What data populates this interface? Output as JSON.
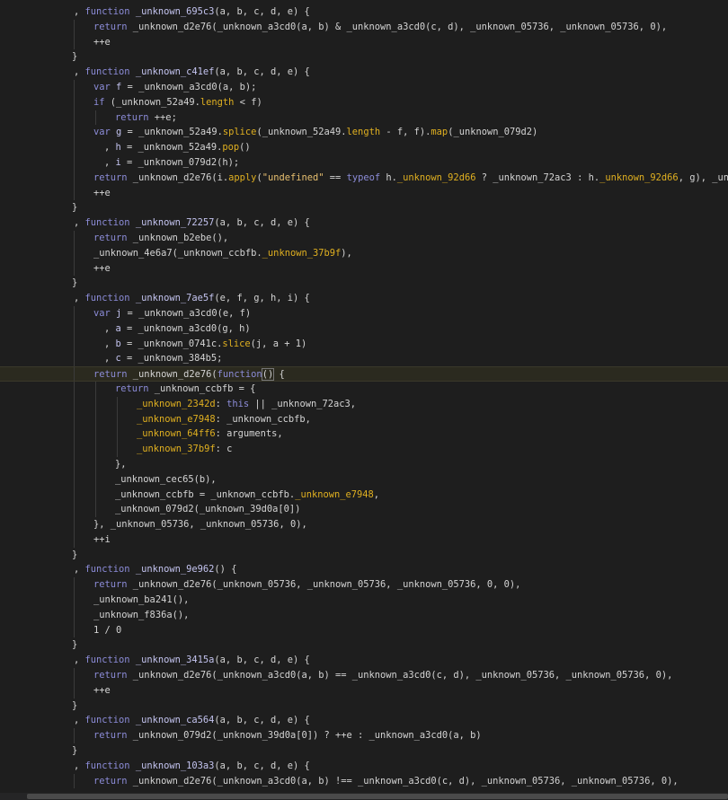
{
  "editor": {
    "current_line": 24,
    "lines": [
      {
        "indent": 82,
        "guides": [],
        "tokens": [
          {
            "t": ", ",
            "c": "pn"
          },
          {
            "t": "function ",
            "c": "kw"
          },
          {
            "t": "_unknown_695c3",
            "c": "fn"
          },
          {
            "t": "(a, b, c, d, e) {",
            "c": "pn"
          }
        ]
      },
      {
        "indent": 104,
        "guides": [
          82
        ],
        "tokens": [
          {
            "t": "return ",
            "c": "kw"
          },
          {
            "t": "_unknown_d2e76(_unknown_a3cd0(a, b) & _unknown_a3cd0(c, d), _unknown_05736, _unknown_05736, 0),",
            "c": "id"
          }
        ]
      },
      {
        "indent": 104,
        "guides": [
          82
        ],
        "tokens": [
          {
            "t": "++e",
            "c": "id"
          }
        ]
      },
      {
        "indent": 80,
        "guides": [],
        "tokens": [
          {
            "t": "}",
            "c": "pn"
          }
        ]
      },
      {
        "indent": 82,
        "guides": [],
        "tokens": [
          {
            "t": ", ",
            "c": "pn"
          },
          {
            "t": "function ",
            "c": "kw"
          },
          {
            "t": "_unknown_c41ef",
            "c": "fn"
          },
          {
            "t": "(a, b, c, d, e) {",
            "c": "pn"
          }
        ]
      },
      {
        "indent": 104,
        "guides": [
          82
        ],
        "tokens": [
          {
            "t": "var ",
            "c": "kw"
          },
          {
            "t": "f",
            "c": "fn"
          },
          {
            "t": " = _unknown_a3cd0(a, b);",
            "c": "id"
          }
        ]
      },
      {
        "indent": 104,
        "guides": [
          82
        ],
        "tokens": [
          {
            "t": "if ",
            "c": "kw"
          },
          {
            "t": "(_unknown_52a49.",
            "c": "id"
          },
          {
            "t": "length",
            "c": "prop"
          },
          {
            "t": " < f)",
            "c": "id"
          }
        ]
      },
      {
        "indent": 128,
        "guides": [
          82,
          106
        ],
        "tokens": [
          {
            "t": "return ",
            "c": "kw"
          },
          {
            "t": "++e;",
            "c": "id"
          }
        ]
      },
      {
        "indent": 104,
        "guides": [
          82
        ],
        "tokens": [
          {
            "t": "var ",
            "c": "kw"
          },
          {
            "t": "g",
            "c": "fn"
          },
          {
            "t": " = _unknown_52a49.",
            "c": "id"
          },
          {
            "t": "splice",
            "c": "prop"
          },
          {
            "t": "(_unknown_52a49.",
            "c": "id"
          },
          {
            "t": "length",
            "c": "prop"
          },
          {
            "t": " - f, f).",
            "c": "id"
          },
          {
            "t": "map",
            "c": "prop"
          },
          {
            "t": "(_unknown_079d2)",
            "c": "id"
          }
        ]
      },
      {
        "indent": 116,
        "guides": [
          82
        ],
        "tokens": [
          {
            "t": ", ",
            "c": "pn"
          },
          {
            "t": "h",
            "c": "fn"
          },
          {
            "t": " = _unknown_52a49.",
            "c": "id"
          },
          {
            "t": "pop",
            "c": "prop"
          },
          {
            "t": "()",
            "c": "id"
          }
        ]
      },
      {
        "indent": 116,
        "guides": [
          82
        ],
        "tokens": [
          {
            "t": ", ",
            "c": "pn"
          },
          {
            "t": "i",
            "c": "fn"
          },
          {
            "t": " = _unknown_079d2(h);",
            "c": "id"
          }
        ]
      },
      {
        "indent": 104,
        "guides": [
          82
        ],
        "tokens": [
          {
            "t": "return ",
            "c": "kw"
          },
          {
            "t": "_unknown_d2e76(i.",
            "c": "id"
          },
          {
            "t": "apply",
            "c": "prop"
          },
          {
            "t": "(",
            "c": "id"
          },
          {
            "t": "\"undefined\"",
            "c": "str"
          },
          {
            "t": " == ",
            "c": "id"
          },
          {
            "t": "typeof ",
            "c": "kw"
          },
          {
            "t": "h.",
            "c": "id"
          },
          {
            "t": "_unknown_92d66",
            "c": "prop"
          },
          {
            "t": " ? _unknown_72ac3 : h.",
            "c": "id"
          },
          {
            "t": "_unknown_92d66",
            "c": "prop"
          },
          {
            "t": ", g), _unknown",
            "c": "id"
          }
        ]
      },
      {
        "indent": 104,
        "guides": [
          82
        ],
        "tokens": [
          {
            "t": "++e",
            "c": "id"
          }
        ]
      },
      {
        "indent": 80,
        "guides": [],
        "tokens": [
          {
            "t": "}",
            "c": "pn"
          }
        ]
      },
      {
        "indent": 82,
        "guides": [],
        "tokens": [
          {
            "t": ", ",
            "c": "pn"
          },
          {
            "t": "function ",
            "c": "kw"
          },
          {
            "t": "_unknown_72257",
            "c": "fn"
          },
          {
            "t": "(a, b, c, d, e) {",
            "c": "pn"
          }
        ]
      },
      {
        "indent": 104,
        "guides": [
          82
        ],
        "tokens": [
          {
            "t": "return ",
            "c": "kw"
          },
          {
            "t": "_unknown_b2ebe(),",
            "c": "id"
          }
        ]
      },
      {
        "indent": 104,
        "guides": [
          82
        ],
        "tokens": [
          {
            "t": "_unknown_4e6a7(_unknown_ccbfb.",
            "c": "id"
          },
          {
            "t": "_unknown_37b9f",
            "c": "prop"
          },
          {
            "t": "),",
            "c": "id"
          }
        ]
      },
      {
        "indent": 104,
        "guides": [
          82
        ],
        "tokens": [
          {
            "t": "++e",
            "c": "id"
          }
        ]
      },
      {
        "indent": 80,
        "guides": [],
        "tokens": [
          {
            "t": "}",
            "c": "pn"
          }
        ]
      },
      {
        "indent": 82,
        "guides": [],
        "tokens": [
          {
            "t": ", ",
            "c": "pn"
          },
          {
            "t": "function ",
            "c": "kw"
          },
          {
            "t": "_unknown_7ae5f",
            "c": "fn"
          },
          {
            "t": "(e, f, g, h, i) {",
            "c": "pn"
          }
        ]
      },
      {
        "indent": 104,
        "guides": [
          82
        ],
        "tokens": [
          {
            "t": "var ",
            "c": "kw"
          },
          {
            "t": "j",
            "c": "fn"
          },
          {
            "t": " = _unknown_a3cd0(e, f)",
            "c": "id"
          }
        ]
      },
      {
        "indent": 116,
        "guides": [
          82
        ],
        "tokens": [
          {
            "t": ", ",
            "c": "pn"
          },
          {
            "t": "a",
            "c": "fn"
          },
          {
            "t": " = _unknown_a3cd0(g, h)",
            "c": "id"
          }
        ]
      },
      {
        "indent": 116,
        "guides": [
          82
        ],
        "tokens": [
          {
            "t": ", ",
            "c": "pn"
          },
          {
            "t": "b",
            "c": "fn"
          },
          {
            "t": " = _unknown_0741c.",
            "c": "id"
          },
          {
            "t": "slice",
            "c": "prop"
          },
          {
            "t": "(j, a + 1)",
            "c": "id"
          }
        ]
      },
      {
        "indent": 116,
        "guides": [
          82
        ],
        "tokens": [
          {
            "t": ", ",
            "c": "pn"
          },
          {
            "t": "c",
            "c": "fn"
          },
          {
            "t": " = _unknown_384b5;",
            "c": "id"
          }
        ]
      },
      {
        "indent": 104,
        "guides": [
          82
        ],
        "tokens": [
          {
            "t": "return ",
            "c": "kw"
          },
          {
            "t": "_unknown_d2e76(",
            "c": "id"
          },
          {
            "t": "function",
            "c": "kw"
          },
          {
            "t": "()",
            "c": "id",
            "b": true
          },
          {
            "t": " {",
            "c": "id"
          }
        ]
      },
      {
        "indent": 128,
        "guides": [
          82,
          106
        ],
        "tokens": [
          {
            "t": "return ",
            "c": "kw"
          },
          {
            "t": "_unknown_ccbfb = {",
            "c": "id"
          }
        ]
      },
      {
        "indent": 152,
        "guides": [
          82,
          106,
          130
        ],
        "tokens": [
          {
            "t": "_unknown_2342d",
            "c": "prop"
          },
          {
            "t": ": ",
            "c": "id"
          },
          {
            "t": "this",
            "c": "kw"
          },
          {
            "t": " || _unknown_72ac3,",
            "c": "id"
          }
        ]
      },
      {
        "indent": 152,
        "guides": [
          82,
          106,
          130
        ],
        "tokens": [
          {
            "t": "_unknown_e7948",
            "c": "prop"
          },
          {
            "t": ": _unknown_ccbfb,",
            "c": "id"
          }
        ]
      },
      {
        "indent": 152,
        "guides": [
          82,
          106,
          130
        ],
        "tokens": [
          {
            "t": "_unknown_64ff6",
            "c": "prop"
          },
          {
            "t": ": arguments,",
            "c": "id"
          }
        ]
      },
      {
        "indent": 152,
        "guides": [
          82,
          106,
          130
        ],
        "tokens": [
          {
            "t": "_unknown_37b9f",
            "c": "prop"
          },
          {
            "t": ": c",
            "c": "id"
          }
        ]
      },
      {
        "indent": 128,
        "guides": [
          82,
          106
        ],
        "tokens": [
          {
            "t": "},",
            "c": "id"
          }
        ]
      },
      {
        "indent": 128,
        "guides": [
          82,
          106
        ],
        "tokens": [
          {
            "t": "_unknown_cec65(b),",
            "c": "id"
          }
        ]
      },
      {
        "indent": 128,
        "guides": [
          82,
          106
        ],
        "tokens": [
          {
            "t": "_unknown_ccbfb = _unknown_ccbfb.",
            "c": "id"
          },
          {
            "t": "_unknown_e7948",
            "c": "prop"
          },
          {
            "t": ",",
            "c": "id"
          }
        ]
      },
      {
        "indent": 128,
        "guides": [
          82,
          106
        ],
        "tokens": [
          {
            "t": "_unknown_079d2(_unknown_39d0a[0])",
            "c": "id"
          }
        ]
      },
      {
        "indent": 104,
        "guides": [
          82
        ],
        "tokens": [
          {
            "t": "}, _unknown_05736, _unknown_05736, 0),",
            "c": "id"
          }
        ]
      },
      {
        "indent": 104,
        "guides": [
          82
        ],
        "tokens": [
          {
            "t": "++i",
            "c": "id"
          }
        ]
      },
      {
        "indent": 80,
        "guides": [],
        "tokens": [
          {
            "t": "}",
            "c": "pn"
          }
        ]
      },
      {
        "indent": 82,
        "guides": [],
        "tokens": [
          {
            "t": ", ",
            "c": "pn"
          },
          {
            "t": "function ",
            "c": "kw"
          },
          {
            "t": "_unknown_9e962",
            "c": "fn"
          },
          {
            "t": "() {",
            "c": "pn"
          }
        ]
      },
      {
        "indent": 104,
        "guides": [
          82
        ],
        "tokens": [
          {
            "t": "return ",
            "c": "kw"
          },
          {
            "t": "_unknown_d2e76(_unknown_05736, _unknown_05736, _unknown_05736, 0, 0),",
            "c": "id"
          }
        ]
      },
      {
        "indent": 104,
        "guides": [
          82
        ],
        "tokens": [
          {
            "t": "_unknown_ba241(),",
            "c": "id"
          }
        ]
      },
      {
        "indent": 104,
        "guides": [
          82
        ],
        "tokens": [
          {
            "t": "_unknown_f836a(),",
            "c": "id"
          }
        ]
      },
      {
        "indent": 104,
        "guides": [
          82
        ],
        "tokens": [
          {
            "t": "1 / 0",
            "c": "id"
          }
        ]
      },
      {
        "indent": 80,
        "guides": [],
        "tokens": [
          {
            "t": "}",
            "c": "pn"
          }
        ]
      },
      {
        "indent": 82,
        "guides": [],
        "tokens": [
          {
            "t": ", ",
            "c": "pn"
          },
          {
            "t": "function ",
            "c": "kw"
          },
          {
            "t": "_unknown_3415a",
            "c": "fn"
          },
          {
            "t": "(a, b, c, d, e) {",
            "c": "pn"
          }
        ]
      },
      {
        "indent": 104,
        "guides": [
          82
        ],
        "tokens": [
          {
            "t": "return ",
            "c": "kw"
          },
          {
            "t": "_unknown_d2e76(_unknown_a3cd0(a, b) == _unknown_a3cd0(c, d), _unknown_05736, _unknown_05736, 0),",
            "c": "id"
          }
        ]
      },
      {
        "indent": 104,
        "guides": [
          82
        ],
        "tokens": [
          {
            "t": "++e",
            "c": "id"
          }
        ]
      },
      {
        "indent": 80,
        "guides": [],
        "tokens": [
          {
            "t": "}",
            "c": "pn"
          }
        ]
      },
      {
        "indent": 82,
        "guides": [],
        "tokens": [
          {
            "t": ", ",
            "c": "pn"
          },
          {
            "t": "function ",
            "c": "kw"
          },
          {
            "t": "_unknown_ca564",
            "c": "fn"
          },
          {
            "t": "(a, b, c, d, e) {",
            "c": "pn"
          }
        ]
      },
      {
        "indent": 104,
        "guides": [
          82
        ],
        "tokens": [
          {
            "t": "return ",
            "c": "kw"
          },
          {
            "t": "_unknown_079d2(_unknown_39d0a[0]) ? ++e : _unknown_a3cd0(a, b)",
            "c": "id"
          }
        ]
      },
      {
        "indent": 80,
        "guides": [],
        "tokens": [
          {
            "t": "}",
            "c": "pn"
          }
        ]
      },
      {
        "indent": 82,
        "guides": [],
        "tokens": [
          {
            "t": ", ",
            "c": "pn"
          },
          {
            "t": "function ",
            "c": "kw"
          },
          {
            "t": "_unknown_103a3",
            "c": "fn"
          },
          {
            "t": "(a, b, c, d, e) {",
            "c": "pn"
          }
        ]
      },
      {
        "indent": 104,
        "guides": [
          82
        ],
        "tokens": [
          {
            "t": "return ",
            "c": "kw"
          },
          {
            "t": "_unknown_d2e76(_unknown_a3cd0(a, b) !== _unknown_a3cd0(c, d), _unknown_05736, _unknown_05736, 0),",
            "c": "id"
          }
        ]
      }
    ]
  }
}
